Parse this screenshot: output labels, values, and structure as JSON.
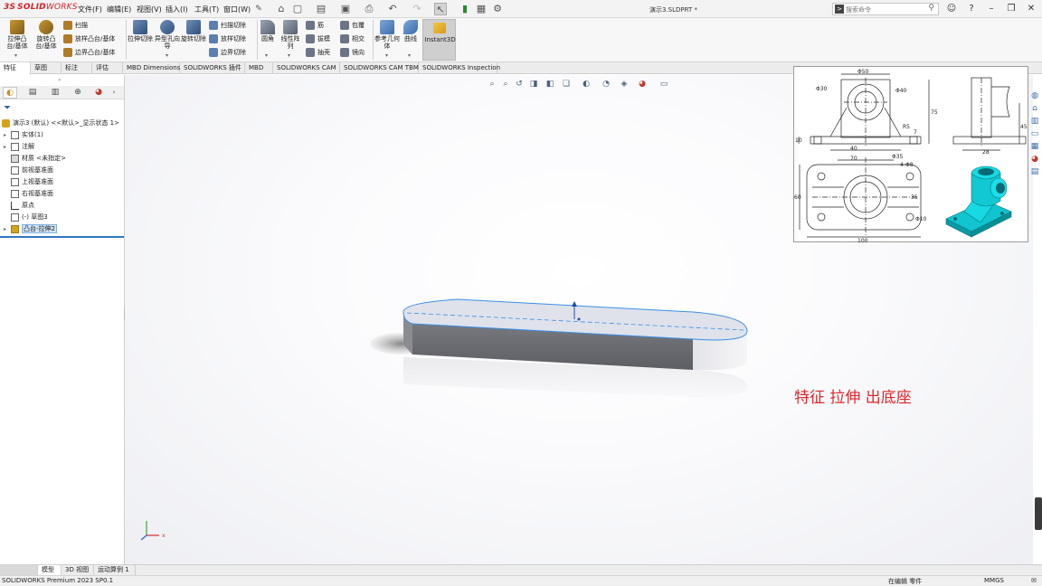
{
  "app": {
    "logo_ds": "3S",
    "logo_solid": "SOLID",
    "logo_works": "WORKS",
    "title": "演示3.SLDPRT *",
    "menu": [
      "文件(F)",
      "编辑(E)",
      "视图(V)",
      "插入(I)",
      "工具(T)",
      "窗口(W)"
    ],
    "search_placeholder": "搜索命令"
  },
  "ribbon": {
    "big_buttons": [
      "拉伸凸台/基体",
      "旋转凸台/基体",
      "拉伸切除",
      "异型孔向导",
      "旋转切除",
      "圆角",
      "线性阵列",
      "参考几何体",
      "曲线"
    ],
    "rows_col1": [
      "扫描",
      "放样凸台/基体",
      "边界凸台/基体"
    ],
    "rows_col2": [
      "扫描切除",
      "放样切除",
      "边界切除"
    ],
    "rows_col3": [
      "筋",
      "拔模",
      "抽壳"
    ],
    "rows_col4": [
      "包覆",
      "相交",
      "镜向"
    ],
    "instant3d": "Instant3D"
  },
  "tabs": [
    "特征",
    "草图",
    "标注",
    "评估",
    "MBD Dimensions",
    "SOLIDWORKS 插件",
    "MBD",
    "SOLIDWORKS CAM",
    "SOLIDWORKS CAM TBM",
    "SOLIDWORKS Inspection"
  ],
  "tree": {
    "root": "演示3 (默认) <<默认>_显示状态 1>",
    "items": [
      "实体(1)",
      "注解",
      "材质 <未指定>",
      "前视基准面",
      "上视基准面",
      "右视基准面",
      "原点",
      "(-) 草图3",
      "凸台-拉伸2"
    ]
  },
  "drawing": {
    "dims": [
      "Φ50",
      "Φ30",
      "Φ40",
      "75",
      "7",
      "R5",
      "45",
      "10",
      "40",
      "70",
      "28",
      "Φ35",
      "4-Φ8",
      "60",
      "35",
      "100",
      "Φ10"
    ]
  },
  "caption": "特征 拉伸 出底座",
  "bottom_tabs": [
    "模型",
    "3D 视图",
    "运动算例 1"
  ],
  "status": {
    "left": "SOLIDWORKS Premium 2023 SP0.1",
    "editing": "在编辑 零件",
    "units": "MMGS"
  },
  "colors": {
    "brand": "#d3222a",
    "caption": "#e0262b",
    "selection": "#2f78c4",
    "part_body": "#7a7c82",
    "iso_part": "#16d9e3"
  }
}
